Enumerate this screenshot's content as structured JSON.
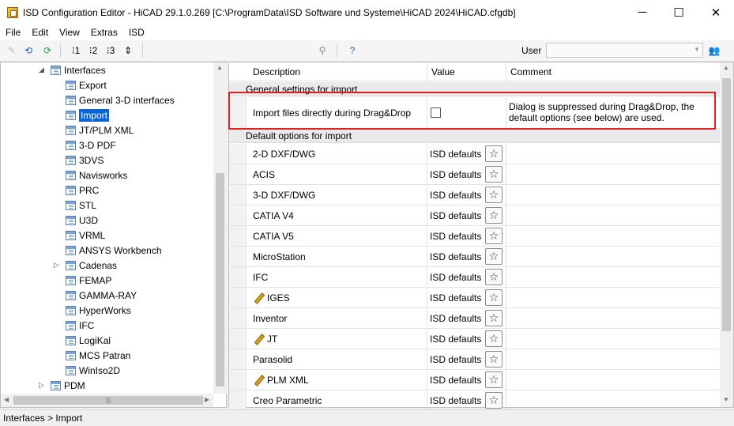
{
  "window": {
    "title": "ISD Configuration Editor  - HiCAD 29.1.0.269 [C:\\ProgramData\\ISD Software und Systeme\\HiCAD 2024\\HiCAD.cfgdb]",
    "minimize": "─",
    "maximize": "☐",
    "close": "✕"
  },
  "menu": [
    "File",
    "Edit",
    "View",
    "Extras",
    "ISD"
  ],
  "toolbar": {
    "user_label": "User",
    "user_value": ""
  },
  "tree": {
    "items": [
      {
        "label": "Interfaces",
        "indent": 1,
        "arrow": "◢"
      },
      {
        "label": "Export",
        "indent": 2
      },
      {
        "label": "General 3-D interfaces",
        "indent": 2
      },
      {
        "label": "Import",
        "indent": 2,
        "selected": true
      },
      {
        "label": "JT/PLM XML",
        "indent": 2
      },
      {
        "label": "3-D PDF",
        "indent": 2
      },
      {
        "label": "3DVS",
        "indent": 2
      },
      {
        "label": "Navisworks",
        "indent": 2
      },
      {
        "label": "PRC",
        "indent": 2
      },
      {
        "label": "STL",
        "indent": 2
      },
      {
        "label": "U3D",
        "indent": 2
      },
      {
        "label": "VRML",
        "indent": 2
      },
      {
        "label": "ANSYS Workbench",
        "indent": 2
      },
      {
        "label": "Cadenas",
        "indent": 2,
        "arrow": "▷"
      },
      {
        "label": "FEMAP",
        "indent": 2
      },
      {
        "label": "GAMMA-RAY",
        "indent": 2
      },
      {
        "label": "HyperWorks",
        "indent": 2
      },
      {
        "label": "IFC",
        "indent": 2
      },
      {
        "label": "LogiKal",
        "indent": 2
      },
      {
        "label": "MCS Patran",
        "indent": 2
      },
      {
        "label": "WinIso2D",
        "indent": 2
      },
      {
        "label": "PDM",
        "indent": 1,
        "arrow": "▷"
      }
    ]
  },
  "grid": {
    "headers": {
      "description": "Description",
      "value": "Value",
      "comment": "Comment"
    },
    "group1": "General settings for import",
    "dragdrop_row": {
      "name": "Import files directly during Drag&Drop",
      "checked": false,
      "comment": "Dialog is suppressed during Drag&Drop, the default options (see below) are used."
    },
    "group2": "Default options for import",
    "rows": [
      {
        "name": "2-D DXF/DWG",
        "value": "ISD defaults",
        "pencil": false
      },
      {
        "name": "ACIS",
        "value": "ISD defaults",
        "pencil": false
      },
      {
        "name": "3-D DXF/DWG",
        "value": "ISD defaults",
        "pencil": false
      },
      {
        "name": "CATIA V4",
        "value": "ISD defaults",
        "pencil": false
      },
      {
        "name": "CATIA V5",
        "value": "ISD defaults",
        "pencil": false
      },
      {
        "name": "MicroStation",
        "value": "ISD defaults",
        "pencil": false
      },
      {
        "name": "IFC",
        "value": "ISD defaults",
        "pencil": false
      },
      {
        "name": "IGES",
        "value": "ISD defaults",
        "pencil": true
      },
      {
        "name": "Inventor",
        "value": "ISD defaults",
        "pencil": false
      },
      {
        "name": "JT",
        "value": "ISD defaults",
        "pencil": true
      },
      {
        "name": "Parasolid",
        "value": "ISD defaults",
        "pencil": false
      },
      {
        "name": "PLM XML",
        "value": "ISD defaults",
        "pencil": true
      },
      {
        "name": "Creo Parametric",
        "value": "ISD defaults",
        "pencil": false
      }
    ]
  },
  "status": "Interfaces > Import",
  "colors": {
    "selection": "#0a64d6",
    "highlight": "#e02020"
  }
}
